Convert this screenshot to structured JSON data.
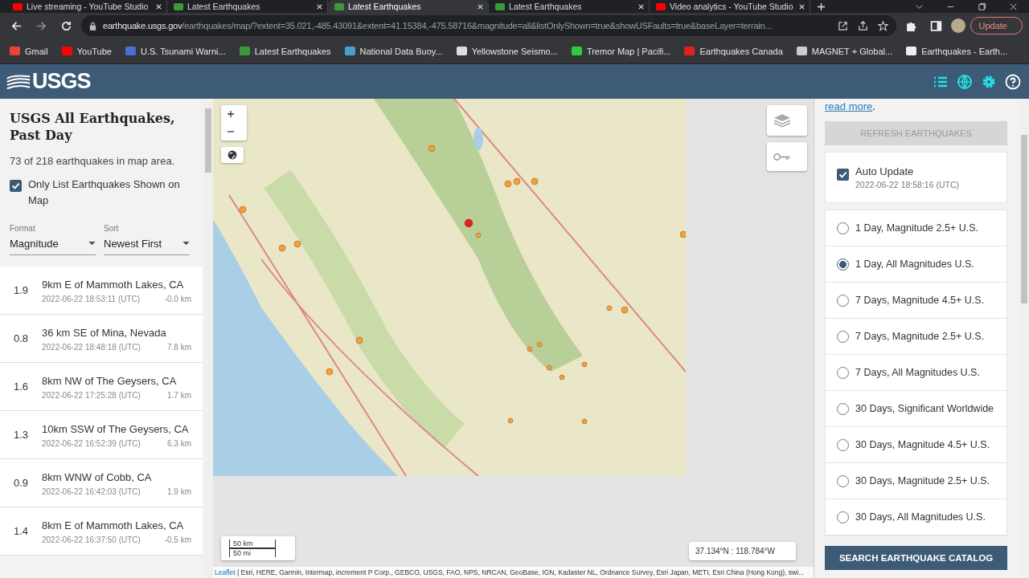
{
  "browser": {
    "tabs": [
      {
        "title": "Live streaming - YouTube Studio",
        "selected": false
      },
      {
        "title": "Latest Earthquakes",
        "selected": false
      },
      {
        "title": "Latest Earthquakes",
        "selected": true
      },
      {
        "title": "Latest Earthquakes",
        "selected": false
      },
      {
        "title": "Video analytics - YouTube Studio",
        "selected": false
      }
    ],
    "url_host": "earthquake.usgs.gov",
    "url_path": "/earthquakes/map/?extent=35.021,-485.43091&extent=41.15384,-475.58716&magnitude=all&listOnlyShown=true&showUSFaults=true&baseLayer=terrain...",
    "update_button": "Update",
    "bookmarks": [
      "Gmail",
      "YouTube",
      "U.S. Tsunami Warni...",
      "Latest Earthquakes",
      "National Data Buoy...",
      "Yellowstone Seismo...",
      "Tremor Map | Pacifi...",
      "Earthquakes Canada",
      "MAGNET + Global...",
      "Earthquakes - Earth..."
    ]
  },
  "header": {
    "logo": "USGS"
  },
  "left_panel": {
    "title": "USGS All Earthquakes, Past Day",
    "count": "73 of 218 earthquakes in map area.",
    "only_list_shown": {
      "label": "Only List Earthquakes Shown on Map",
      "checked": true
    },
    "format": {
      "label": "Format",
      "value": "Magnitude"
    },
    "sort": {
      "label": "Sort",
      "value": "Newest First"
    },
    "earthquakes": [
      {
        "magnitude": "1.9",
        "place": "9km E of Mammoth Lakes, CA",
        "time": "2022-06-22 18:53:11 (UTC)",
        "depth": "-0.0 km"
      },
      {
        "magnitude": "0.8",
        "place": "36 km SE of Mina, Nevada",
        "time": "2022-06-22 18:48:18 (UTC)",
        "depth": "7.8 km"
      },
      {
        "magnitude": "1.6",
        "place": "8km NW of The Geysers, CA",
        "time": "2022-06-22 17:25:28 (UTC)",
        "depth": "1.7 km"
      },
      {
        "magnitude": "1.3",
        "place": "10km SSW of The Geysers, CA",
        "time": "2022-06-22 16:52:39 (UTC)",
        "depth": "6.3 km"
      },
      {
        "magnitude": "0.9",
        "place": "8km WNW of Cobb, CA",
        "time": "2022-06-22 16:42:03 (UTC)",
        "depth": "1.9 km"
      },
      {
        "magnitude": "1.4",
        "place": "8km E of Mammoth Lakes, CA",
        "time": "2022-06-22 16:37:50 (UTC)",
        "depth": "-0.5 km"
      }
    ]
  },
  "map": {
    "scale_km": "50 km",
    "scale_mi": "50 mi",
    "coordinates": "37.134°N : 118.784°W",
    "attribution_link": "Leaflet",
    "attribution": "| Esri, HERE, Garmin, Intermap, increment P Corp., GEBCO, USGS, FAO, NPS, NRCAN, GeoBase, IGN, Kadaster NL, Ordnance Survey, Esri Japan, METI, Esri China (Hong Kong), swi..."
  },
  "right_panel": {
    "read_more": "read more",
    "read_more_end": ".",
    "refresh_button": "REFRESH EARTHQUAKES",
    "auto_update": {
      "label": "Auto Update",
      "time": "2022-06-22 18:58:16 (UTC)",
      "checked": true
    },
    "feeds": [
      {
        "label": "1 Day, Magnitude 2.5+ U.S.",
        "selected": false
      },
      {
        "label": "1 Day, All Magnitudes U.S.",
        "selected": true
      },
      {
        "label": "7 Days, Magnitude 4.5+ U.S.",
        "selected": false
      },
      {
        "label": "7 Days, Magnitude 2.5+ U.S.",
        "selected": false
      },
      {
        "label": "7 Days, All Magnitudes U.S.",
        "selected": false
      },
      {
        "label": "30 Days, Significant Worldwide",
        "selected": false
      },
      {
        "label": "30 Days, Magnitude 4.5+ U.S.",
        "selected": false
      },
      {
        "label": "30 Days, Magnitude 2.5+ U.S.",
        "selected": false
      },
      {
        "label": "30 Days, All Magnitudes U.S.",
        "selected": false
      }
    ],
    "search_button": "SEARCH EARTHQUAKE CATALOG"
  }
}
